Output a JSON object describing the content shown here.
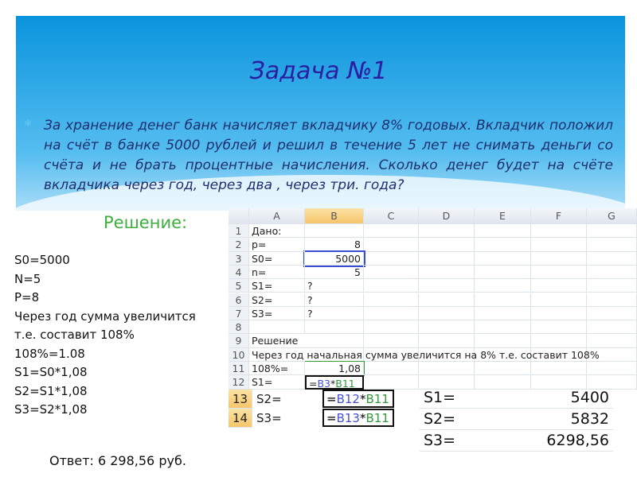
{
  "title": "Задача №1",
  "problem": "За хранение денег банк начисляет вкладчику 8% годовых. Вкладчик положил на счёт в банке 5000 рублей и решил в течение 5 лет не снимать деньги со счёта и не брать процентные начисления. Сколько денег будет на счёте вкладчика через год, через два , через три. года?",
  "solution_label": "Решение:",
  "left_lines": [
    "S0=5000",
    "N=5",
    "P=8",
    "Через год сумма увеличится",
    "т.е. составит 108%",
    "108%=1.08",
    "S1=S0*1,08",
    "S2=S1*1,08",
    "S3=S2*1,08"
  ],
  "sheet": {
    "columns": [
      "A",
      "B",
      "C",
      "D",
      "E",
      "F",
      "G"
    ],
    "rows": [
      {
        "n": "1",
        "a": "Дано:",
        "b": ""
      },
      {
        "n": "2",
        "a": "p=",
        "b": "8"
      },
      {
        "n": "3",
        "a": "S0=",
        "b": "5000"
      },
      {
        "n": "4",
        "a": "n=",
        "b": "5"
      },
      {
        "n": "5",
        "a": "S1=",
        "b": "?"
      },
      {
        "n": "6",
        "a": "S2=",
        "b": "?"
      },
      {
        "n": "7",
        "a": "S3=",
        "b": "?"
      },
      {
        "n": "8",
        "a": "",
        "b": ""
      },
      {
        "n": "9",
        "a": "Решение",
        "b": ""
      },
      {
        "n": "10",
        "a": "Через год начальная сумма увеличится на 8% т.е. составит 108%",
        "b": ""
      },
      {
        "n": "11",
        "a": "108%=",
        "b": "1,08"
      },
      {
        "n": "12",
        "a": "S1=",
        "b": ""
      }
    ],
    "b12": {
      "eq": "=",
      "r1": "B3",
      "op": "*",
      "r2": "B11"
    },
    "extra": [
      {
        "n": "13",
        "a": "S2=",
        "eq": "=",
        "r1": "B12",
        "op": "*",
        "r2": "B11"
      },
      {
        "n": "14",
        "a": "S3=",
        "eq": "=",
        "r1": "B13",
        "op": "*",
        "r2": "B11"
      }
    ]
  },
  "results": [
    {
      "label": "S1=",
      "value": "5400"
    },
    {
      "label": "S2=",
      "value": "5832"
    },
    {
      "label": "S3=",
      "value": "6298,56"
    }
  ],
  "answer": "Ответ: 6 298,56 руб."
}
